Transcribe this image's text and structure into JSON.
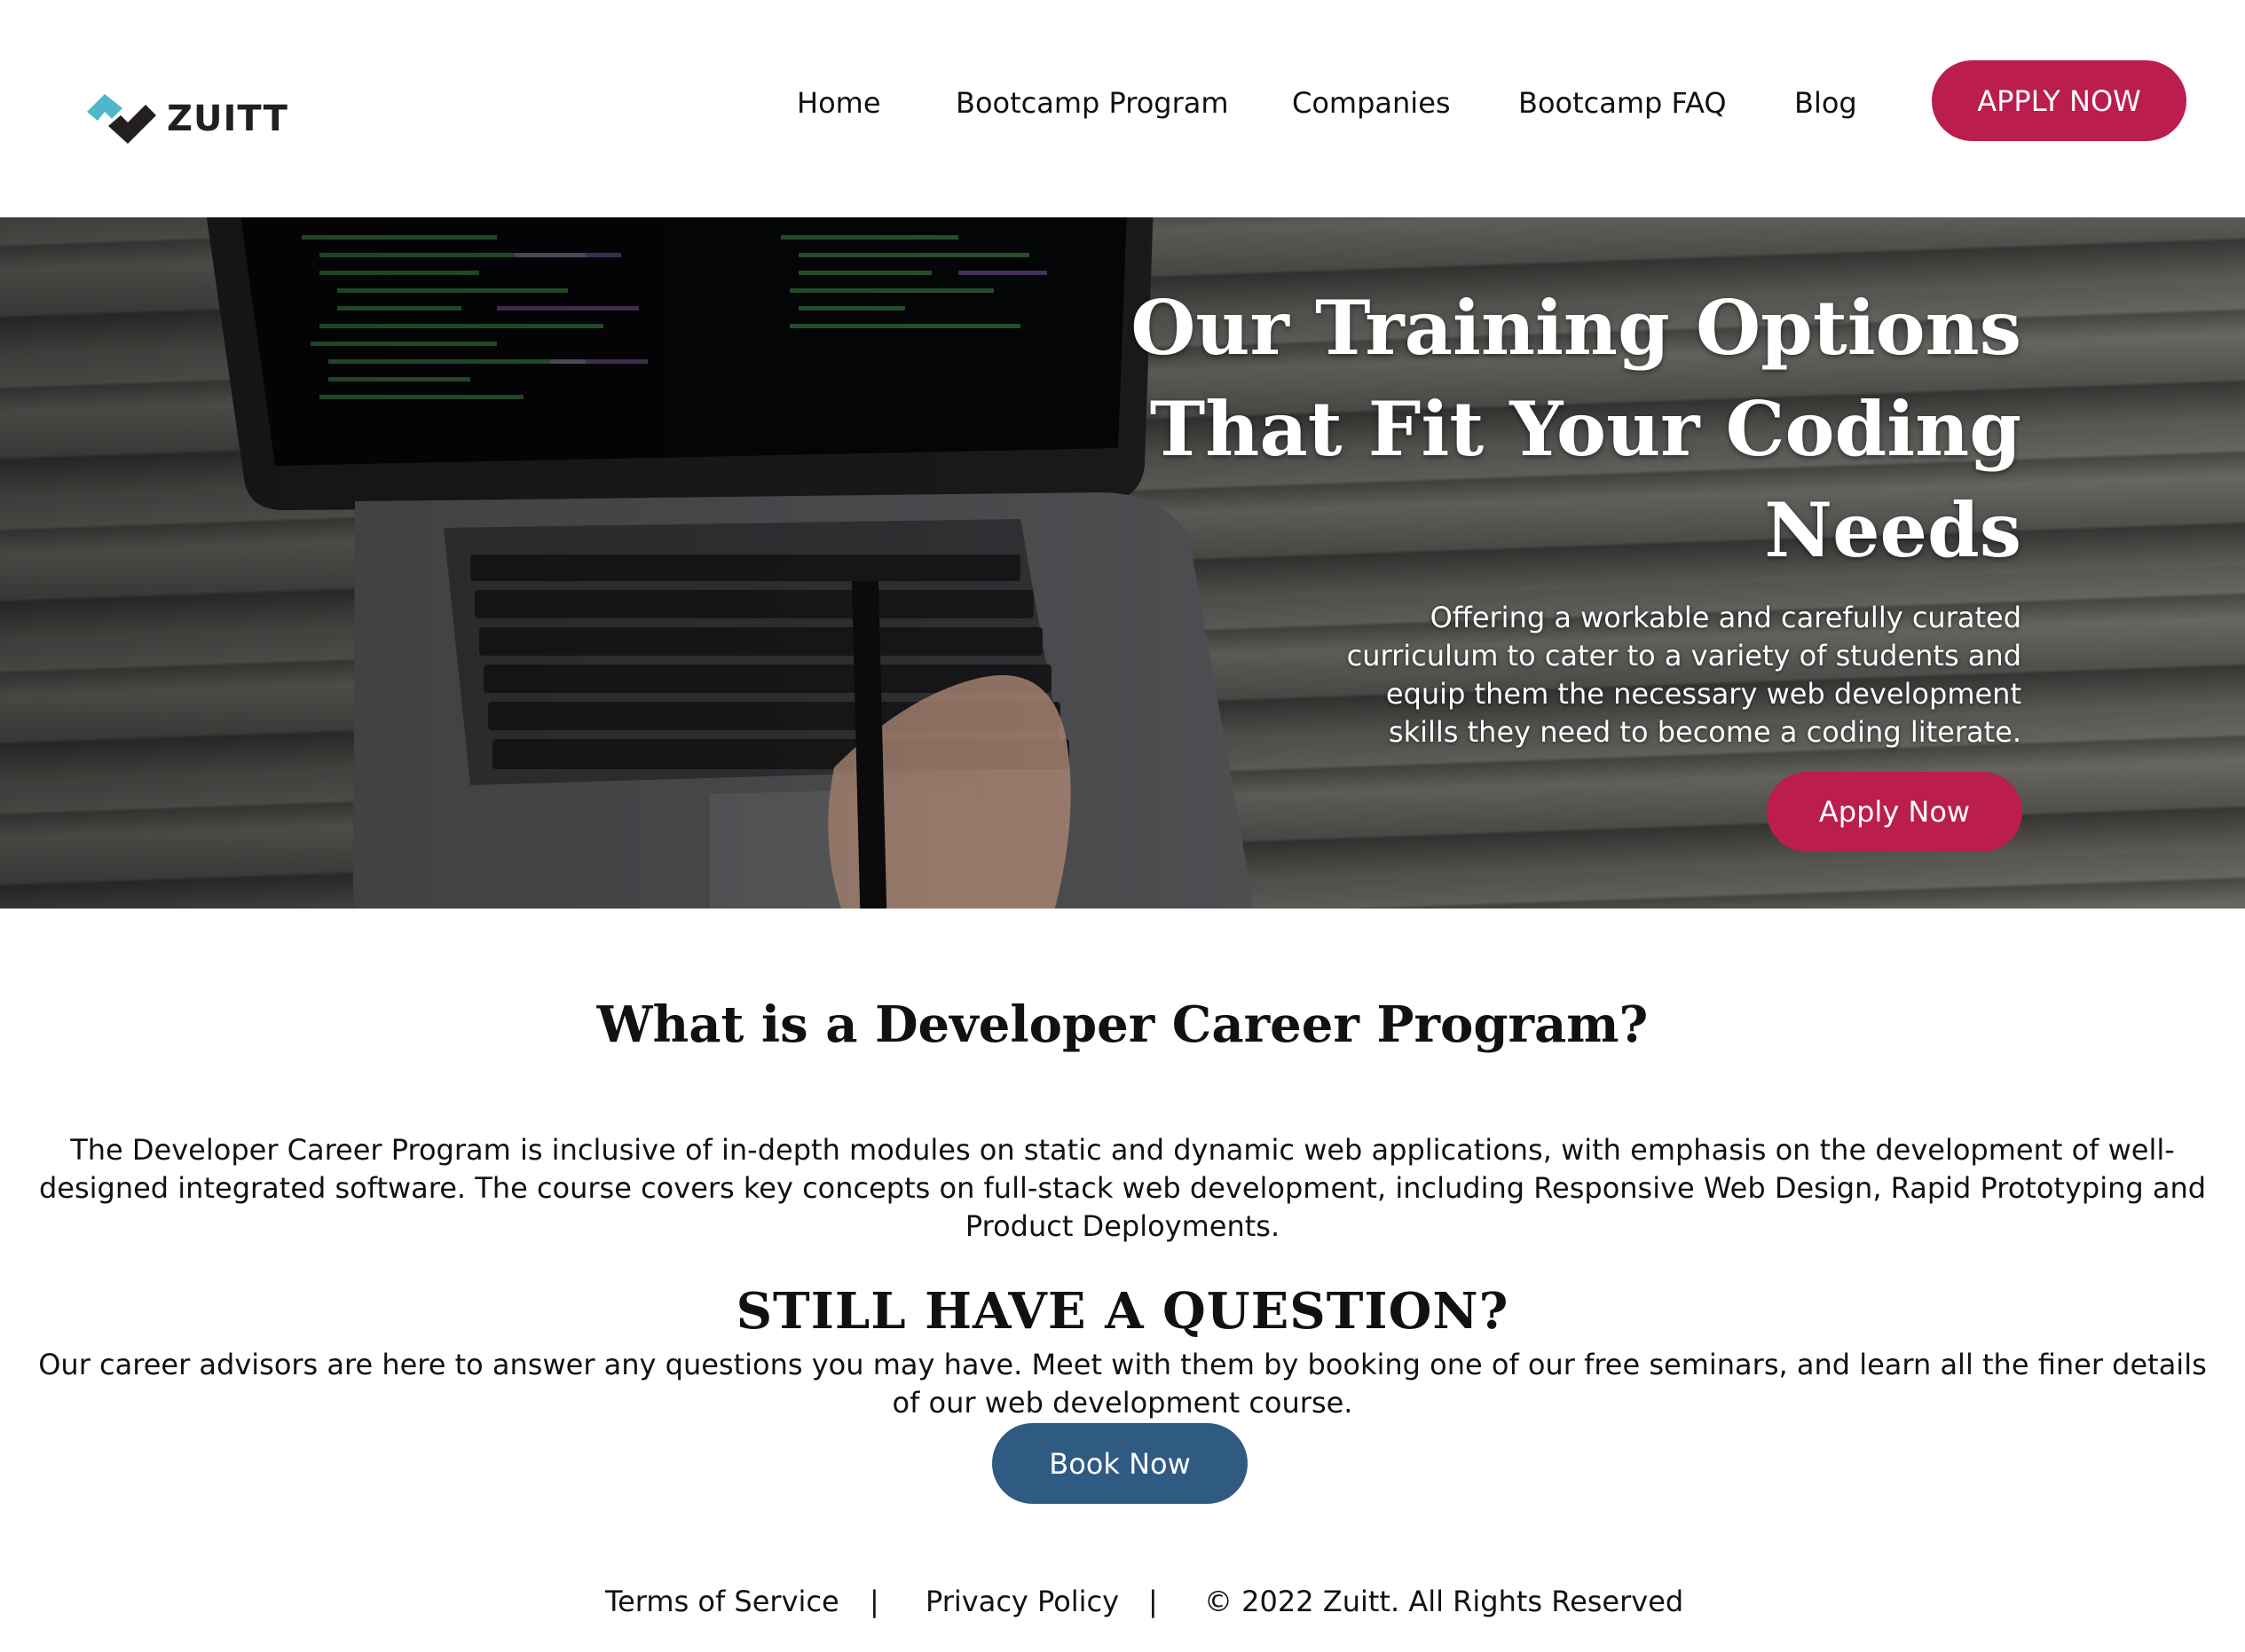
{
  "header": {
    "logo_text": "ZUITT",
    "nav": {
      "home": "Home",
      "bootcamp_program": "Bootcamp Program",
      "companies": "Companies",
      "bootcamp_faq": "Bootcamp FAQ",
      "blog": "Blog"
    },
    "apply_label": "APPLY NOW"
  },
  "hero": {
    "title_lines": [
      "Our Training Options",
      "That Fit Your Coding",
      "Needs"
    ],
    "subtitle": "Offering a workable and carefully curated curriculum to cater to a variety of students and equip them the necessary web development skills they need to become a coding literate.",
    "apply_label": "Apply Now"
  },
  "program": {
    "title": "What is a Developer Career Program?",
    "text": "The Developer Career Program is inclusive of in-depth modules on static and dynamic web applications, with emphasis on the development of well-designed integrated software. The course covers key concepts on full-stack web development, including Responsive Web Design, Rapid Prototyping and Product Deployments."
  },
  "question": {
    "title": "STILL HAVE A QUESTION?",
    "text": "Our career advisors are here to answer any questions you may have. Meet with them by booking one of our free seminars, and learn all the finer details of our web development course.",
    "book_label": "Book Now"
  },
  "footer": {
    "terms": "Terms of Service",
    "separator": "|",
    "privacy": "Privacy Policy",
    "copyright": "© 2022 Zuitt. All Rights Reserved"
  },
  "colors": {
    "accent": "#bb1d4f",
    "secondary": "#2f5a82",
    "logo_teal": "#4fb7c9",
    "logo_dark": "#231f20"
  },
  "icons": {
    "logo": "zuitt-logo-icon"
  }
}
